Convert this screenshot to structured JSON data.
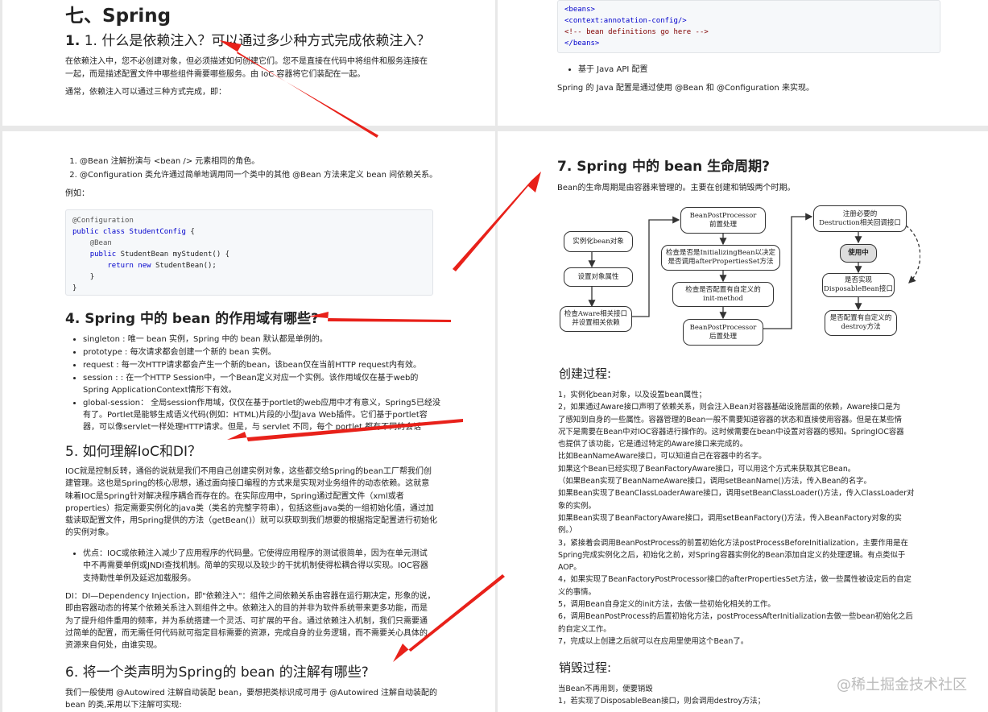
{
  "p1": {
    "title": "七、Spring",
    "q1": "1. 什么是依赖注入？可以通过多少种方式完成依赖注入？",
    "para1a": "在依赖注入中，您不必创建对象，但必须描述如何创建它们。您不是直接在代码中将组件和服务连接在",
    "para1b": "一起，而是描述配置文件中哪些组件需要哪些服务。由 IoC 容器将它们装配在一起。",
    "para2": "通常，依赖注入可以通过三种方式完成，即："
  },
  "p2": {
    "code_lines": [
      "<beans>",
      "<context:annotation-config/>",
      "<!-- bean definitions go here -->",
      "</beans>"
    ],
    "bullet": "基于 Java API 配置",
    "para": "Spring 的 Java 配置是通过使用 @Bean 和 @Configuration 来实现。"
  },
  "p3": {
    "list1": [
      "@Bean 注解扮演与 <bean /> 元素相同的角色。",
      "@Configuration 类允许通过简单地调用同一个类中的其他 @Bean 方法来定义 bean 间依赖关系。"
    ],
    "example": "例如：",
    "code": {
      "l1": "@Configuration",
      "l2a": "public class ",
      "l2b": "StudentConfig",
      "l2c": " {",
      "l3": "@Bean",
      "l4a": "public",
      "l4b": " StudentBean myStudent() {",
      "l5a": "return new",
      "l5b": " StudentBean();",
      "l6": "}",
      "l7": "}"
    },
    "q4": "4. Spring 中的 bean 的作用域有哪些?",
    "scopes": [
      "singleton : 唯一 bean 实例，Spring 中的 bean 默认都是单例的。",
      "prototype : 每次请求都会创建一个新的 bean 实例。",
      "request : 每一次HTTP请求都会产生一个新的bean，该bean仅在当前HTTP request内有效。",
      "session : : 在一个HTTP Session中，一个Bean定义对应一个实例。该作用域仅在基于web的",
      "Spring ApplicationContext情形下有效。",
      "global-session： 全局session作用域，仅仅在基于portlet的web应用中才有意义，Spring5已经没",
      "有了。Portlet是能够生成语义代码(例如：HTML)片段的小型Java Web插件。它们基于portlet容",
      "器，可以像servlet一样处理HTTP请求。但是，与 servlet 不同，每个 portlet 都有不同的会话"
    ],
    "q5": "5. 如何理解IoC和DI？",
    "ioc": [
      "IOC就是控制反转，通俗的说就是我们不用自己创建实例对象，这些都交给Spring的bean工厂帮我们创",
      "建管理。这也是Spring的核心思想，通过面向接口编程的方式来是实现对业务组件的动态依赖。这就意",
      "味着IOC是Spring针对解决程序耦合而存在的。在实际应用中，Spring通过配置文件（xml或者",
      "properties）指定需要实例化的java类（类名的完整字符串），包括这些java类的一组初始化值，通过加",
      "载读取配置文件，用Spring提供的方法（getBean()）就可以获取到我们想要的根据指定配置进行初始化",
      "的实例对象。"
    ],
    "adv": [
      "优点：IOC或依赖注入减少了应用程序的代码量。它使得应用程序的测试很简单，因为在单元测试",
      "中不再需要单例或JNDI查找机制。简单的实现以及较少的干扰机制使得松耦合得以实现。IOC容器",
      "支持勤性单例及延迟加载服务。"
    ],
    "di": [
      "DI：DI—Dependency Injection，即\"依赖注入\"：组件之间依赖关系由容器在运行期决定，形象的说，",
      "即由容器动态的将某个依赖关系注入到组件之中。依赖注入的目的并非为软件系统带来更多功能，而是",
      "为了提升组件重用的频率，并为系统搭建一个灵活、可扩展的平台。通过依赖注入机制，我们只需要通",
      "过简单的配置，而无需任何代码就可指定目标需要的资源，完成自身的业务逻辑，而不需要关心具体的",
      "资源来自何处，由谁实现。"
    ],
    "q6": "6. 将一个类声明为Spring的 bean 的注解有哪些?",
    "p6": [
      "我们一般使用 @Autowired 注解自动装配 bean，要想把类标识成可用于 @Autowired 注解自动装配的",
      "bean 的类,采用以下注解可实现:"
    ]
  },
  "p4": {
    "q7": "7. Spring 中的 bean 生命周期?",
    "intro": "Bean的生命周期是由容器来管理的。主要在创建和销毁两个时期。",
    "diagram": {
      "instantiate": "实例化bean对象",
      "set_props": "设置对象属性",
      "aware_1": "检查Aware相关接口",
      "aware_2": "并设置相关依赖",
      "bpp_pre_1": "BeanPostProcessor",
      "bpp_pre_2": "前置处理",
      "init_bean_1": "检查是否是InitializingBean以决定",
      "init_bean_2": "是否调用afterPropertiesSet方法",
      "init_method_1": "检查是否配置有自定义的",
      "init_method_2": "init-method",
      "bpp_post_1": "BeanPostProcessor",
      "bpp_post_2": "后置处理",
      "register_1": "注册必要的",
      "register_2": "Destruction相关回调接口",
      "in_use": "使用中",
      "disposable_1": "是否实现",
      "disposable_2": "DisposableBean接口",
      "destroy_1": "是否配置有自定义的",
      "destroy_2": "destroy方法"
    },
    "create_title": "创建过程:",
    "create_lines": [
      "1，实例化bean对象，以及设置bean属性；",
      "2，如果通过Aware接口声明了依赖关系，则会注入Bean对容器基础设施层面的依赖，Aware接口是为",
      "了感知到自身的一些属性。容器管理的Bean一般不需要知道容器的状态和直接使用容器。但是在某些情",
      "况下是需要在Bean中对IOC容器进行操作的。这时候需要在bean中设置对容器的感知。SpringIOC容器",
      "也提供了该功能，它是通过特定的Aware接口来完成的。",
      "比如BeanNameAware接口，可以知道自己在容器中的名字。",
      "如果这个Bean已经实现了BeanFactoryAware接口，可以用这个方式来获取其它Bean。",
      "（如果Bean实现了BeanNameAware接口，调用setBeanName()方法，传入Bean的名字。",
      "如果Bean实现了BeanClassLoaderAware接口，调用setBeanClassLoader()方法，传入ClassLoader对",
      "象的实例。",
      "如果Bean实现了BeanFactoryAware接口，调用setBeanFactory()方法，传入BeanFactory对象的实",
      "例。）",
      "3，紧接着会调用BeanPostProcess的前置初始化方法postProcessBeforeInitialization，主要作用是在",
      "Spring完成实例化之后，初始化之前，对Spring容器实例化的Bean添加自定义的处理逻辑。有点类似于",
      "AOP。",
      "4，如果实现了BeanFactoryPostProcessor接口的afterPropertiesSet方法，做一些属性被设定后的自定",
      "义的事情。",
      "5，调用Bean自身定义的init方法，去做一些初始化相关的工作。",
      "6，调用BeanPostProcess的后置初始化方法，postProcessAfterInitialization去做一些bean初始化之后",
      "的自定义工作。",
      "7，完成以上创建之后就可以在应用里使用这个Bean了。"
    ],
    "destroy_title": "销毁过程:",
    "destroy_lines": [
      "当Bean不再用到，便要销毁",
      "1，若实现了DisposableBean接口，则会调用destroy方法；"
    ]
  },
  "watermark": "@稀土掘金技术社区",
  "colors": {
    "arrow": "#e8211a",
    "page_bg": "#ffffff",
    "gap": "#e8e8e8"
  }
}
